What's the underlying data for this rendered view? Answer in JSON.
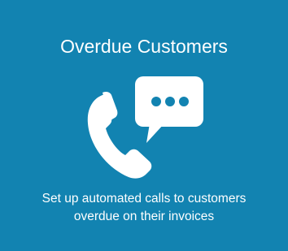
{
  "tile": {
    "title": "Overdue Customers",
    "description_line1": "Set up automated calls to customers",
    "description_line2": "overdue on their invoices",
    "icon": "phone-with-speech-bubble-icon",
    "background_color": "#1283b1",
    "foreground_color": "#ffffff"
  }
}
